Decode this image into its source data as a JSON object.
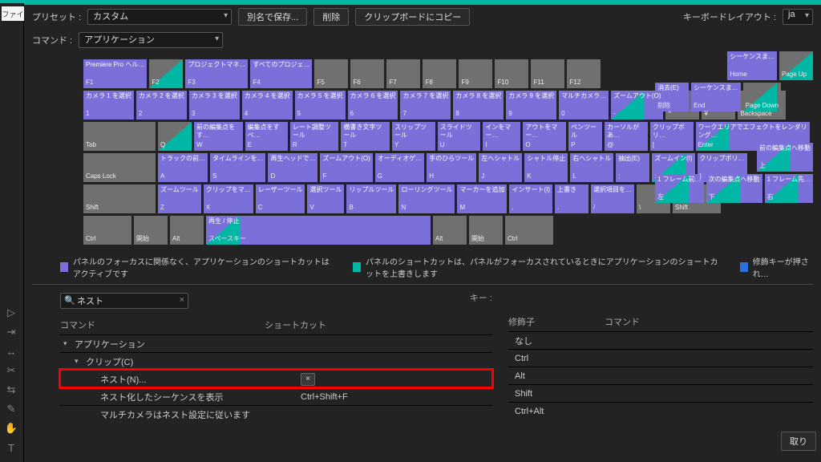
{
  "leftStrip": {
    "tab": "ファイ"
  },
  "toolbar": {
    "preset_label": "プリセット :",
    "preset_value": "カスタム",
    "save_as": "別名で保存...",
    "delete": "削除",
    "copy_clipboard": "クリップボードにコピー",
    "kb_layout_label": "キーボードレイアウト :",
    "kb_layout_value": "ja",
    "command_label": "コマンド :",
    "command_value": "アプリケーション"
  },
  "keyboard": {
    "frow": [
      {
        "top": "Premiere Pro ヘル…",
        "bot": "F1",
        "cls": "purple"
      },
      {
        "top": "",
        "bot": "F2",
        "cls": "gray half"
      },
      {
        "top": "プロジェクトマネ…",
        "bot": "F3",
        "cls": "purple"
      },
      {
        "top": "すべてのプロジェ…",
        "bot": "F4",
        "cls": "purple"
      },
      {
        "top": "",
        "bot": "F5",
        "cls": "gray"
      },
      {
        "top": "",
        "bot": "F6",
        "cls": "gray"
      },
      {
        "top": "",
        "bot": "F7",
        "cls": "gray"
      },
      {
        "top": "",
        "bot": "F8",
        "cls": "gray"
      },
      {
        "top": "",
        "bot": "F9",
        "cls": "gray"
      },
      {
        "top": "",
        "bot": "F10",
        "cls": "gray"
      },
      {
        "top": "",
        "bot": "F11",
        "cls": "gray"
      },
      {
        "top": "",
        "bot": "F12",
        "cls": "gray"
      }
    ],
    "row1": [
      {
        "top": "カメラ 1 を選択",
        "bot": "1",
        "cls": "purple wide"
      },
      {
        "top": "カメラ 2 を選択",
        "bot": "2",
        "cls": "purple"
      },
      {
        "top": "カメラ 3 を選択",
        "bot": "3",
        "cls": "purple"
      },
      {
        "top": "カメラ 4 を選択",
        "bot": "4",
        "cls": "purple"
      },
      {
        "top": "カメラ 5 を選択",
        "bot": "5",
        "cls": "purple"
      },
      {
        "top": "カメラ 6 を選択",
        "bot": "6",
        "cls": "purple"
      },
      {
        "top": "カメラ 7 を選択",
        "bot": "7",
        "cls": "purple"
      },
      {
        "top": "カメラ 8 を選択",
        "bot": "8",
        "cls": "purple"
      },
      {
        "top": "カメラ 9 を選択",
        "bot": "9",
        "cls": "purple"
      },
      {
        "top": "マルチカメラ…",
        "bot": "0",
        "cls": "purple"
      },
      {
        "top": "ズームアウト(O)",
        "bot": "-",
        "cls": "purple half"
      },
      {
        "top": "",
        "bot": "^",
        "cls": "gray"
      },
      {
        "top": "",
        "bot": "¥",
        "cls": "gray"
      },
      {
        "top": "",
        "bot": "Backspace",
        "cls": "gray wide"
      }
    ],
    "row2": [
      {
        "top": "",
        "bot": "Tab",
        "cls": "gray wider"
      },
      {
        "top": "",
        "bot": "Q",
        "cls": "gray half"
      },
      {
        "top": "前の編集点をす…",
        "bot": "W",
        "cls": "purple"
      },
      {
        "top": "編集点をすべ…",
        "bot": "E",
        "cls": "purple"
      },
      {
        "top": "レート調整ツール",
        "bot": "R",
        "cls": "purple"
      },
      {
        "top": "横書き文字ツール",
        "bot": "T",
        "cls": "purple"
      },
      {
        "top": "スリップツール",
        "bot": "Y",
        "cls": "purple"
      },
      {
        "top": "スライドツール",
        "bot": "U",
        "cls": "purple"
      },
      {
        "top": "インをマー…",
        "bot": "I",
        "cls": "purple"
      },
      {
        "top": "アウトをマー…",
        "bot": "O",
        "cls": "purple"
      },
      {
        "top": "ペンツール",
        "bot": "P",
        "cls": "purple"
      },
      {
        "top": "カーソルがあ…",
        "bot": "@",
        "cls": "purple"
      },
      {
        "top": "クリップボリ…",
        "bot": "[",
        "cls": "purple"
      },
      {
        "top": "ワークエリアでエフェクトをレンダリング…",
        "bot": "Enter",
        "cls": "purple wide half"
      }
    ],
    "row3": [
      {
        "top": "",
        "bot": "Caps Lock",
        "cls": "gray wider"
      },
      {
        "top": "トラックの前…",
        "bot": "A",
        "cls": "purple"
      },
      {
        "top": "タイムラインを…",
        "bot": "S",
        "cls": "purple"
      },
      {
        "top": "再生ヘッドで…",
        "bot": "D",
        "cls": "purple"
      },
      {
        "top": "ズームアウト(O)",
        "bot": "F",
        "cls": "purple"
      },
      {
        "top": "オーディオゲ…",
        "bot": "G",
        "cls": "purple"
      },
      {
        "top": "手のひらツール",
        "bot": "H",
        "cls": "purple"
      },
      {
        "top": "左へシャトル",
        "bot": "J",
        "cls": "purple"
      },
      {
        "top": "シャトル停止",
        "bot": "K",
        "cls": "purple"
      },
      {
        "top": "右へシャトル",
        "bot": "L",
        "cls": "purple"
      },
      {
        "top": "抽出(E)",
        "bot": ";",
        "cls": "purple"
      },
      {
        "top": "ズームイン(I)",
        "bot": ":",
        "cls": "purple half"
      },
      {
        "top": "クリップボリ…",
        "bot": "]",
        "cls": "purple"
      }
    ],
    "row4": [
      {
        "top": "",
        "bot": "Shift",
        "cls": "gray wider"
      },
      {
        "top": "ズームツール",
        "bot": "Z",
        "cls": "purple"
      },
      {
        "top": "クリップをマ…",
        "bot": "X",
        "cls": "purple"
      },
      {
        "top": "レーザーツール",
        "bot": "C",
        "cls": "purple"
      },
      {
        "top": "選択ツール",
        "bot": "V",
        "cls": "purple"
      },
      {
        "top": "リップルツール",
        "bot": "B",
        "cls": "purple"
      },
      {
        "top": "ローリングツール",
        "bot": "N",
        "cls": "purple"
      },
      {
        "top": "マーカーを追加",
        "bot": "M",
        "cls": "purple"
      },
      {
        "top": "インサート(I)",
        "bot": ",",
        "cls": "purple"
      },
      {
        "top": "上書き",
        "bot": ".",
        "cls": "purple"
      },
      {
        "top": "選択項目を…",
        "bot": "/",
        "cls": "purple"
      },
      {
        "top": "",
        "bot": "\\",
        "cls": "gray"
      },
      {
        "top": "",
        "bot": "Shift",
        "cls": "gray wide"
      }
    ],
    "row5": [
      {
        "top": "",
        "bot": "Ctrl",
        "cls": "gray wide"
      },
      {
        "top": "",
        "bot": "開始",
        "cls": "gray"
      },
      {
        "top": "",
        "bot": "Alt",
        "cls": "gray"
      },
      {
        "top": "再生 / 停止",
        "bot": "スペースキー",
        "cls": "purple space half"
      },
      {
        "top": "",
        "bot": "Alt",
        "cls": "gray"
      },
      {
        "top": "",
        "bot": "開始",
        "cls": "gray"
      },
      {
        "top": "",
        "bot": "Ctrl",
        "cls": "gray wide"
      }
    ]
  },
  "nav": {
    "r1": [
      {
        "top": "シーケンスま…",
        "bot": "Home",
        "cls": "purple"
      },
      {
        "top": "",
        "bot": "Page Up",
        "cls": "gray half"
      }
    ],
    "r2": [
      {
        "top": "消去(E)",
        "bot": "削除",
        "cls": "purple"
      },
      {
        "top": "シーケンスま…",
        "bot": "End",
        "cls": "purple"
      },
      {
        "top": "",
        "bot": "Page Down",
        "cls": "gray half"
      }
    ],
    "r3": [
      {
        "top": "前の編集点へ移動",
        "bot": "上",
        "cls": "purple half"
      }
    ],
    "r4": [
      {
        "top": "1 フレーム前…",
        "bot": "左",
        "cls": "purple half"
      },
      {
        "top": "次の編集点へ移動",
        "bot": "下",
        "cls": "purple half"
      },
      {
        "top": "1 フレーム先…",
        "bot": "右",
        "cls": "purple half"
      }
    ]
  },
  "legend": {
    "purple": "パネルのフォーカスに関係なく、アプリケーションのショートカットはアクティブです",
    "green": "パネルのショートカットは、パネルがフォーカスされているときにアプリケーションのショートカットを上書きします",
    "blue": "修飾キーが押され…"
  },
  "lower": {
    "search_value": "ネスト",
    "keys_label": "キー :",
    "col1_h1": "コマンド",
    "col1_h2": "ショートカット",
    "col2_h1": "修飾子",
    "col2_h2": "コマンド",
    "rows": [
      {
        "name": "アプリケーション",
        "shortcut": "",
        "indent": 0,
        "arrow": "▾"
      },
      {
        "name": "クリップ(C)",
        "shortcut": "",
        "indent": 1,
        "arrow": "▾"
      },
      {
        "name": "ネスト(N)...",
        "shortcut": "×",
        "indent": 2,
        "arrow": "",
        "hl": true
      },
      {
        "name": "ネスト化したシーケンスを表示",
        "shortcut": "Ctrl+Shift+F",
        "indent": 2,
        "arrow": ""
      },
      {
        "name": "マルチカメラはネスト設定に従います",
        "shortcut": "",
        "indent": 2,
        "arrow": ""
      }
    ],
    "mods": [
      "なし",
      "Ctrl",
      "Alt",
      "Shift",
      "Ctrl+Alt"
    ],
    "undo_btn": "取り"
  }
}
